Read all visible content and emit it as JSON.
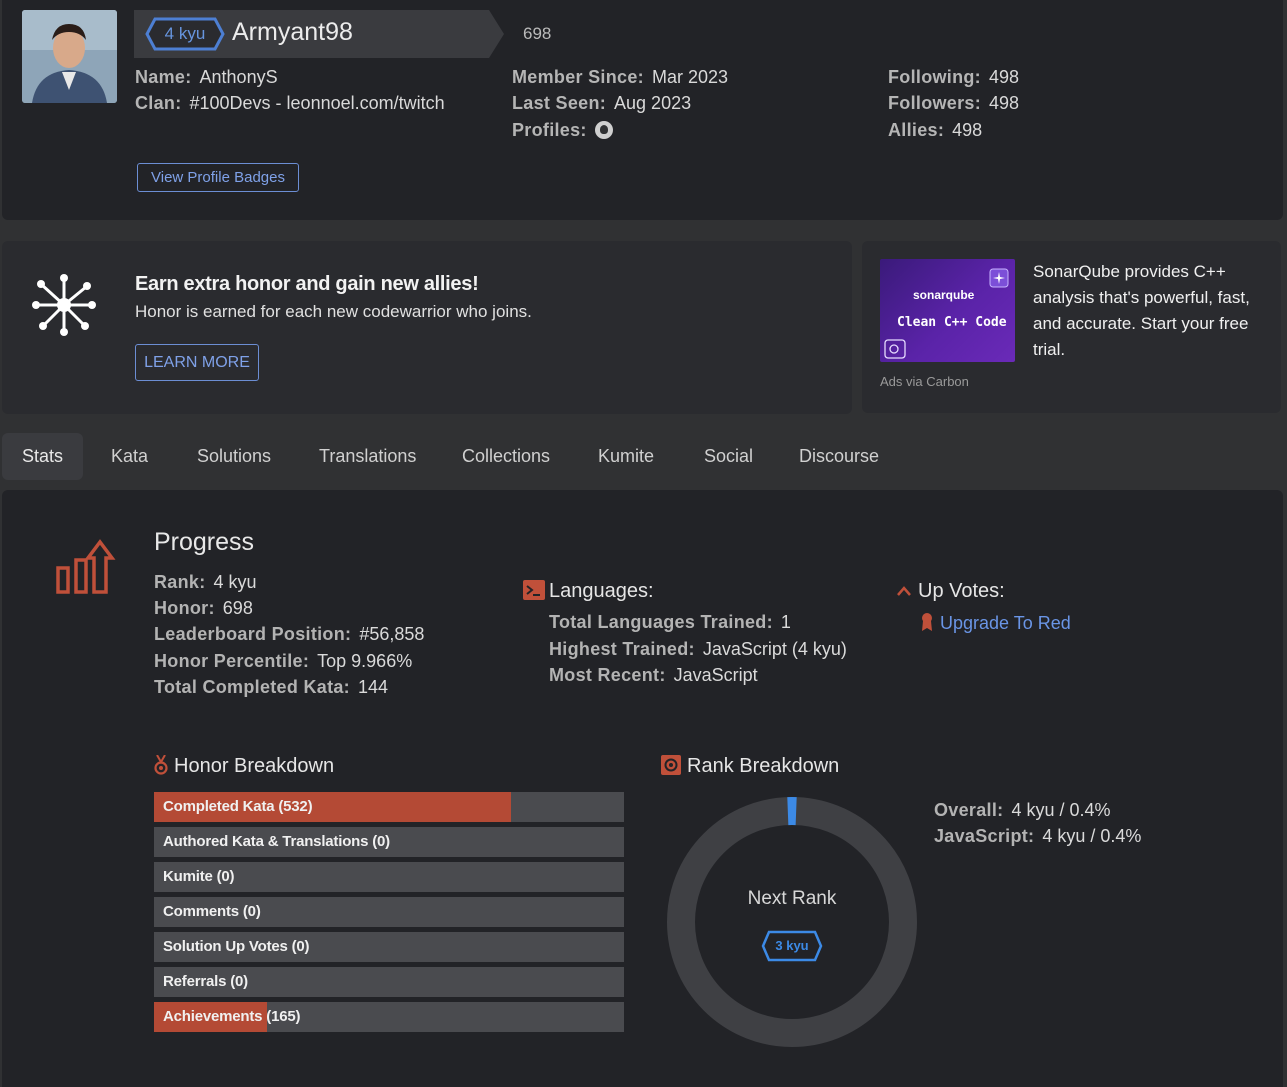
{
  "profile": {
    "rank_badge": "4 kyu",
    "username": "Armyant98",
    "honor": "698",
    "name_label": "Name:",
    "name_value": "AnthonyS",
    "clan_label": "Clan:",
    "clan_value": "#100Devs - leonnoel.com/twitch",
    "member_since_label": "Member Since:",
    "member_since_value": "Mar 2023",
    "last_seen_label": "Last Seen:",
    "last_seen_value": "Aug 2023",
    "profiles_label": "Profiles:",
    "following_label": "Following:",
    "following_value": "498",
    "followers_label": "Followers:",
    "followers_value": "498",
    "allies_label": "Allies:",
    "allies_value": "498",
    "view_badges_label": "View Profile Badges"
  },
  "promo": {
    "title": "Earn extra honor and gain new allies!",
    "text": "Honor is earned for each new codewarrior who joins.",
    "button_label": "LEARN MORE"
  },
  "ad": {
    "brand": "sonarqube",
    "image_caption": "Clean C++ Code",
    "text": "SonarQube provides C++ analysis that's powerful, fast, and accurate. Start your free trial.",
    "via": "Ads via Carbon"
  },
  "tabs": [
    {
      "label": "Stats",
      "active": true
    },
    {
      "label": "Kata",
      "active": false
    },
    {
      "label": "Solutions",
      "active": false
    },
    {
      "label": "Translations",
      "active": false
    },
    {
      "label": "Collections",
      "active": false
    },
    {
      "label": "Kumite",
      "active": false
    },
    {
      "label": "Social",
      "active": false
    },
    {
      "label": "Discourse",
      "active": false
    }
  ],
  "progress": {
    "title": "Progress",
    "rank_label": "Rank:",
    "rank_value": "4 kyu",
    "honor_label": "Honor:",
    "honor_value": "698",
    "leaderboard_label": "Leaderboard Position:",
    "leaderboard_value": "#56,858",
    "percentile_label": "Honor Percentile:",
    "percentile_value": "Top 9.966%",
    "completed_label": "Total Completed Kata:",
    "completed_value": "144"
  },
  "languages": {
    "title": "Languages:",
    "trained_label": "Total Languages Trained:",
    "trained_value": "1",
    "highest_label": "Highest Trained:",
    "highest_value": "JavaScript (4 kyu)",
    "recent_label": "Most Recent:",
    "recent_value": "JavaScript"
  },
  "upvotes": {
    "title": "Up Votes:",
    "link": "Upgrade To Red"
  },
  "honor_breakdown": {
    "title": "Honor Breakdown",
    "items": [
      {
        "label": "Completed Kata (532)",
        "fill": 0.76
      },
      {
        "label": "Authored Kata & Translations (0)",
        "fill": 0
      },
      {
        "label": "Kumite (0)",
        "fill": 0
      },
      {
        "label": "Comments (0)",
        "fill": 0
      },
      {
        "label": "Solution Up Votes (0)",
        "fill": 0
      },
      {
        "label": "Referrals (0)",
        "fill": 0
      },
      {
        "label": "Achievements (165)",
        "fill": 0.24
      }
    ]
  },
  "rank_breakdown": {
    "title": "Rank Breakdown",
    "next_rank_label": "Next Rank",
    "next_rank_badge": "3 kyu",
    "progress_fraction": 0.004,
    "overall_label": "Overall:",
    "overall_value": "4 kyu / 0.4%",
    "js_label": "JavaScript:",
    "js_value": "4 kyu / 0.4%"
  },
  "colors": {
    "accent_red": "#b44a35",
    "link_blue": "#6a95e6",
    "rank_blue": "#3c8ae6"
  }
}
